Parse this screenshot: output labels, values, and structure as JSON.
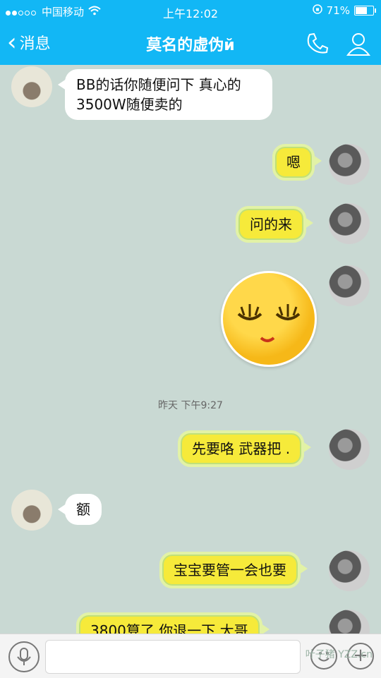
{
  "status": {
    "carrier": "中国移动",
    "time": "上午12:02",
    "battery": "71%",
    "battery_level": 0.71
  },
  "nav": {
    "back_label": "消息",
    "title": "莫名的虚伪й"
  },
  "messages": [
    {
      "side": "left",
      "lines": [
        "BB的话你随便问下 真心的",
        "3500W随便卖的"
      ]
    },
    {
      "side": "right",
      "text": "嗯"
    },
    {
      "side": "right",
      "text": "问的来"
    },
    {
      "side": "right",
      "emoji": "smiling-face-closed-eyes"
    },
    {
      "side": "right",
      "text": "先要咯  武器把 ."
    },
    {
      "side": "left",
      "text": "额"
    },
    {
      "side": "right",
      "text": "宝宝要管一会也要"
    },
    {
      "side": "right",
      "text": "3800算了 你退一下 大哥"
    }
  ],
  "timestamp": "昨天 下午9:27",
  "watermark": "叶子猪 YZZ.cn",
  "colors": {
    "nav_blue": "#12b7f5",
    "chat_bg": "#c9d9d3",
    "bubble_yellow": "#f6ea3a",
    "bubble_white": "#ffffff"
  }
}
